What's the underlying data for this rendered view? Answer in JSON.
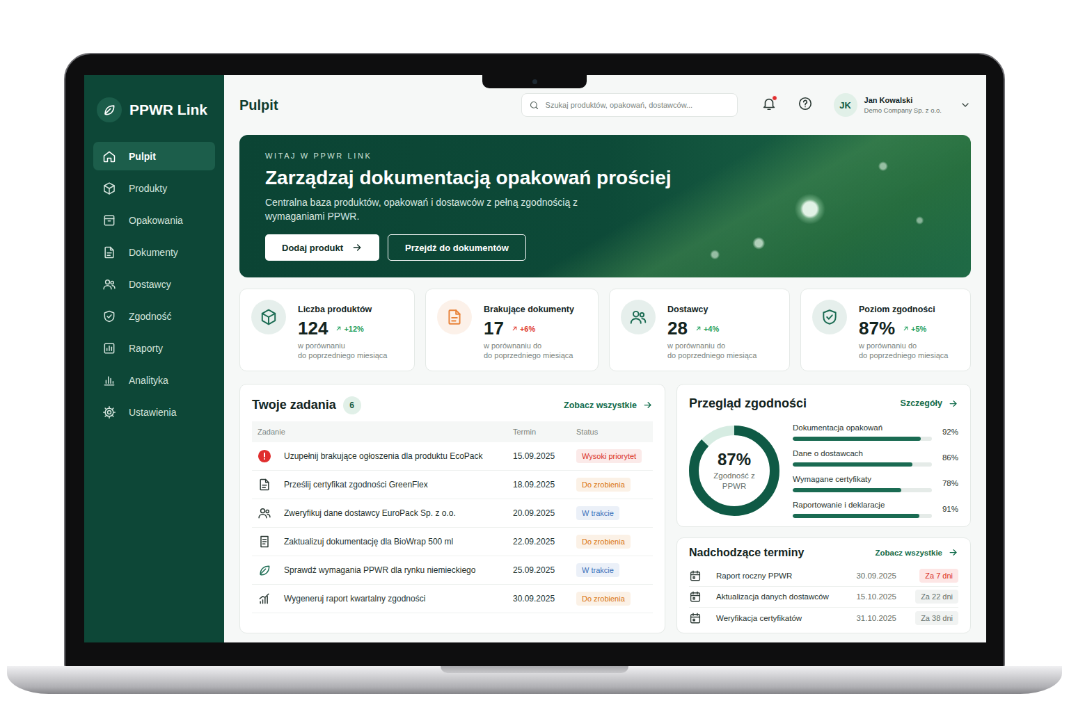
{
  "app": {
    "name": "PPWR Link"
  },
  "sidebar": {
    "items": [
      {
        "label": "Pulpit",
        "selected": true
      },
      {
        "label": "Produkty",
        "selected": false
      },
      {
        "label": "Opakowania",
        "selected": false
      },
      {
        "label": "Dokumenty",
        "selected": false
      },
      {
        "label": "Dostawcy",
        "selected": false
      },
      {
        "label": "Zgodność",
        "selected": false
      },
      {
        "label": "Raporty",
        "selected": false
      },
      {
        "label": "Analityka",
        "selected": false
      },
      {
        "label": "Ustawienia",
        "selected": false
      }
    ]
  },
  "header": {
    "title": "Pulpit",
    "search": {
      "placeholder": "Szukaj produktów, opakowań, dostawców..."
    },
    "notifications": {
      "unread": true
    },
    "user": {
      "initials": "JK",
      "name": "Jan Kowalski",
      "company": "Demo Company Sp. z o.o."
    }
  },
  "hero": {
    "eyebrow": "WITAJ W PPWR LINK",
    "title": "Zarządzaj dokumentacją opakowań prościej",
    "subtitle": "Centralna baza produktów, opakowań i dostawców z pełną zgodnością z wymaganiami PPWR.",
    "buttons": [
      {
        "label": "Dodaj produkt",
        "kind": "primary"
      },
      {
        "label": "Przejdź do dokumentów",
        "kind": "outline"
      }
    ]
  },
  "stats": [
    {
      "label": "Liczba produktów",
      "value": "124",
      "change": "+12%",
      "note": [
        "w porównaniu",
        "do poprzedniego miesiąca"
      ],
      "color": "#1a6b52",
      "change_color": "#1e9e5a"
    },
    {
      "label": "Brakujące dokumenty",
      "value": "17",
      "change": "+6%",
      "note": [
        "w porównaniu do",
        "do poprzedniego miesiąca"
      ],
      "color": "#e8833a",
      "change_color": "#e03a2f"
    },
    {
      "label": "Dostawcy",
      "value": "28",
      "change": "+4%",
      "note": [
        "w porównaniu do",
        "do poprzedniego miesiąca"
      ],
      "color": "#1a6b52",
      "change_color": "#1e9e5a"
    },
    {
      "label": "Poziom zgodności",
      "value": "87%",
      "change": "+5%",
      "note": [
        "w porównaniu do",
        "do poprzedniego miesiąca"
      ],
      "color": "#1a6b52",
      "change_color": "#1e9e5a"
    }
  ],
  "tasks": {
    "title": "Twoje zadania",
    "count": "6",
    "link": "Zobacz wszystkie",
    "columns": [
      "Zadanie",
      "Termin",
      "Status"
    ],
    "rows": [
      {
        "task": "Uzupełnij brakujące ogłoszenia dla produktu EcoPack",
        "date": "15.09.2025",
        "status": "Wysoki priorytet",
        "color": "#d93025"
      },
      {
        "task": "Prześlij certyfikat zgodności GreenFlex",
        "date": "18.09.2025",
        "status": "Do zrobienia",
        "color": "#d9730d"
      },
      {
        "task": "Zweryfikuj dane dostawcy EuroPack Sp. z o.o.",
        "date": "20.09.2025",
        "status": "W trakcie",
        "color": "#3a6fb8"
      },
      {
        "task": "Zaktualizuj dokumentację dla BioWrap 500 ml",
        "date": "22.09.2025",
        "status": "Do zrobienia",
        "color": "#d9730d"
      },
      {
        "task": "Sprawdź wymagania PPWR dla rynku niemieckiego",
        "date": "25.09.2025",
        "status": "W trakcie",
        "color": "#3a6fb8"
      },
      {
        "task": "Wygeneruj raport kwartalny zgodności",
        "date": "30.09.2025",
        "status": "Do zrobienia",
        "color": "#d9730d"
      }
    ]
  },
  "compliance": {
    "title": "Przegląd zgodności",
    "link": "Szczegóły",
    "ring": {
      "value": "87%",
      "label": "Zgodność z PPWR",
      "level": 0.87
    },
    "items": [
      {
        "label": "Dokumentacja opakowań",
        "value": "92%",
        "level": 0.92
      },
      {
        "label": "Dane o dostawcach",
        "value": "86%",
        "level": 0.86
      },
      {
        "label": "Wymagane certyfikaty",
        "value": "78%",
        "level": 0.78
      },
      {
        "label": "Raportowanie i deklaracje",
        "value": "91%",
        "level": 0.91
      }
    ]
  },
  "deadlines": {
    "title": "Nadchodzące terminy",
    "link": "Zobacz wszystkie",
    "rows": [
      {
        "label": "Raport roczny PPWR",
        "date": "30.09.2025",
        "badge": "Za 7 dni",
        "urgent": true
      },
      {
        "label": "Aktualizacja danych dostawców",
        "date": "15.10.2025",
        "badge": "Za 22 dni",
        "urgent": false
      },
      {
        "label": "Weryfikacja certyfikatów",
        "date": "31.10.2025",
        "badge": "Za 38 dni",
        "urgent": false
      }
    ]
  }
}
